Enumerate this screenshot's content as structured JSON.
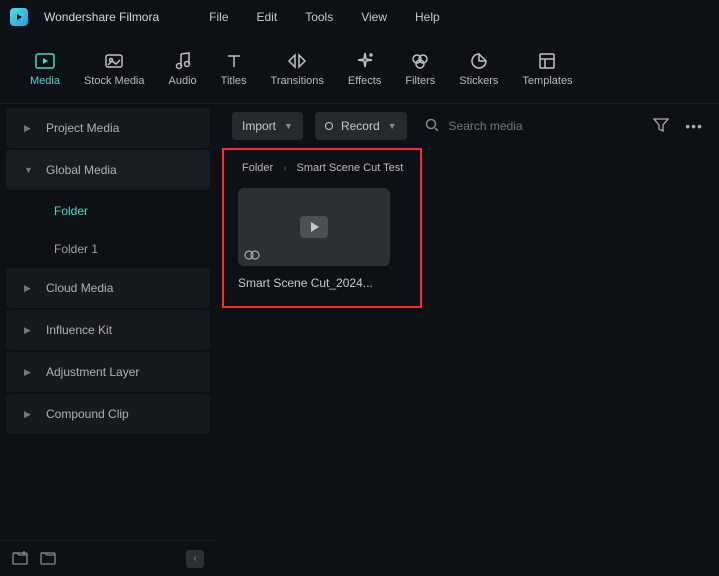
{
  "app": {
    "title": "Wondershare Filmora"
  },
  "menu": {
    "file": "File",
    "edit": "Edit",
    "tools": "Tools",
    "view": "View",
    "help": "Help"
  },
  "tools": {
    "media": "Media",
    "stock_media": "Stock Media",
    "audio": "Audio",
    "titles": "Titles",
    "transitions": "Transitions",
    "effects": "Effects",
    "filters": "Filters",
    "stickers": "Stickers",
    "templates": "Templates"
  },
  "sidebar": {
    "project_media": "Project Media",
    "global_media": "Global Media",
    "folder": "Folder",
    "folder1": "Folder 1",
    "cloud_media": "Cloud Media",
    "influence_kit": "Influence Kit",
    "adjustment_layer": "Adjustment Layer",
    "compound_clip": "Compound Clip"
  },
  "actions": {
    "import": "Import",
    "record": "Record",
    "search_placeholder": "Search media"
  },
  "breadcrumb": {
    "root": "Folder",
    "current": "Smart Scene Cut Test"
  },
  "clip": {
    "label": "Smart Scene Cut_2024..."
  }
}
